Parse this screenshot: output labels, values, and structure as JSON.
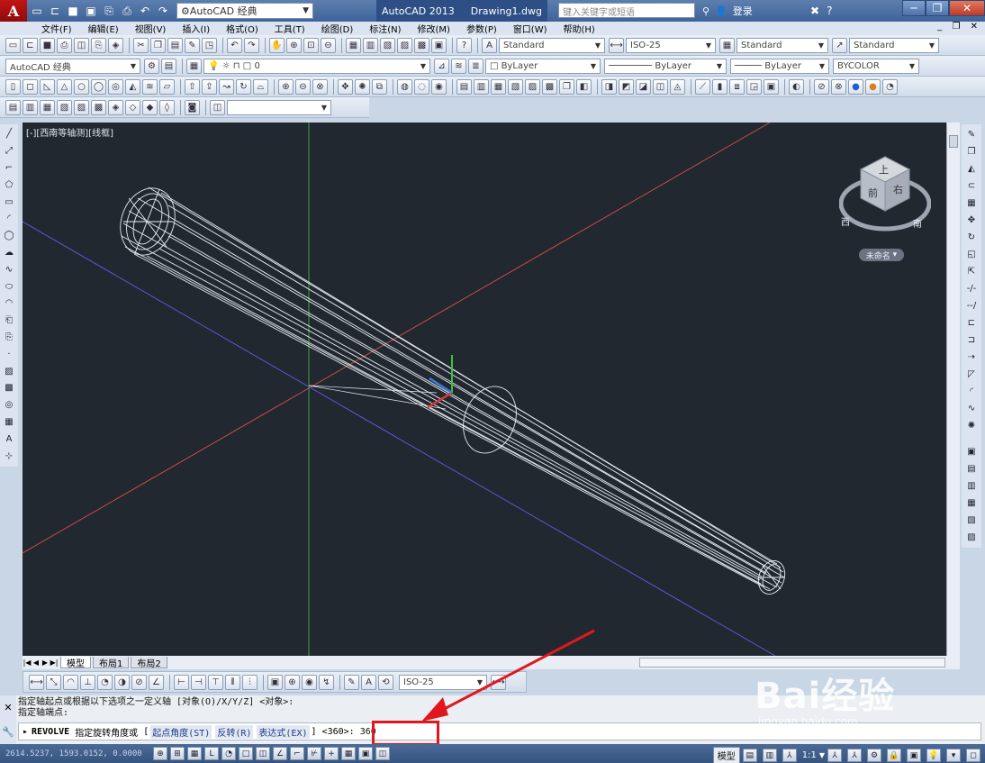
{
  "titlebar": {
    "workspace": "AutoCAD 经典",
    "app_name": "AutoCAD 2013",
    "document": "Drawing1.dwg",
    "search_placeholder": "键入关键字或短语",
    "login_label": "登录"
  },
  "menu": [
    "文件(F)",
    "编辑(E)",
    "视图(V)",
    "插入(I)",
    "格式(O)",
    "工具(T)",
    "绘图(D)",
    "标注(N)",
    "修改(M)",
    "参数(P)",
    "窗口(W)",
    "帮助(H)"
  ],
  "styles_toolbar": {
    "text_style": "Standard",
    "dim_style": "ISO-25",
    "table_style": "Standard",
    "multileader_style": "Standard"
  },
  "layers_toolbar": {
    "workspace": "AutoCAD 经典",
    "layer": "0",
    "color": "ByLayer",
    "linetype": "ByLayer",
    "lineweight": "ByLayer",
    "plot_style": "BYCOLOR"
  },
  "viewport": {
    "label": "[-][西南等轴测][线框]",
    "background": "#212830",
    "named_view": "未命名"
  },
  "navcube": {
    "top": "上",
    "front": "前",
    "right": "右",
    "west": "西",
    "south": "南"
  },
  "tabs": {
    "model": "模型",
    "layout1": "布局1",
    "layout2": "布局2"
  },
  "dim_toolbar": {
    "dim_style": "ISO-25"
  },
  "command": {
    "history_1": "指定轴起点或根据以下选项之一定义轴 [对象(O)/X/Y/Z] <对象>:",
    "history_2": "指定轴端点:",
    "command_name": "REVOLVE",
    "prompt": "指定旋转角度或",
    "bracket_open": "[",
    "opt_start_angle": "起点角度(ST)",
    "opt_reverse": "反转(R)",
    "opt_expression": "表达式(EX)",
    "bracket_close": "]",
    "default_value": "<360>:",
    "input_value": "360"
  },
  "statusbar": {
    "coordinates": "2614.5237, 1593.0152, 0.0000",
    "model_label": "模型",
    "annotation_scale": "1:1"
  },
  "watermark": {
    "brand": "Bai经验",
    "site": "jingyan.baidu.com"
  },
  "colors": {
    "x_axis": "#d23a3a",
    "y_axis": "#3ba33b",
    "z_axis": "#5a5ad8",
    "highlight": "#e0181e"
  }
}
